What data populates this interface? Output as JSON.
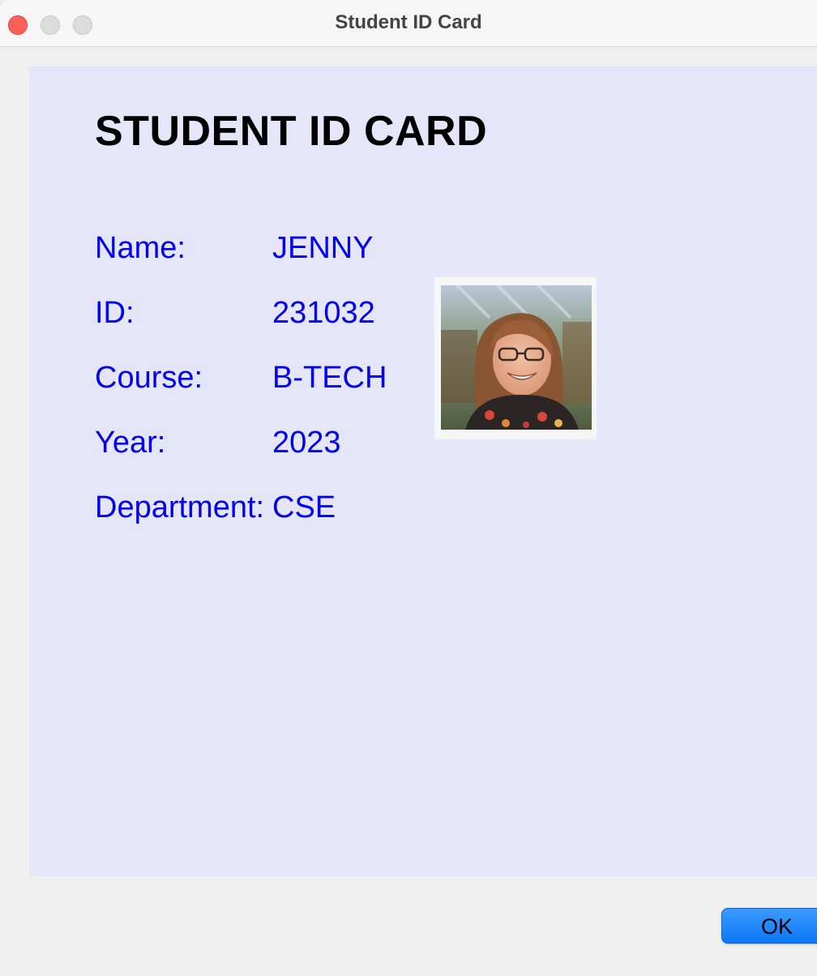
{
  "window": {
    "title": "Student ID Card",
    "controls": {
      "close_color": "#fe5f57",
      "min_color": "#dcdcdc",
      "max_color": "#dcdcdc"
    }
  },
  "card": {
    "background": "#e6e6fa",
    "heading": "STUDENT ID CARD",
    "text_color": "#0000ee",
    "fields": [
      {
        "label": "Name:",
        "value": "JENNY"
      },
      {
        "label": "ID:",
        "value": "231032"
      },
      {
        "label": "Course:",
        "value": "B-TECH"
      },
      {
        "label": "Year:",
        "value": "2023"
      },
      {
        "label": "Department:",
        "value": "CSE"
      }
    ],
    "photo_icon": "student-photo"
  },
  "footer": {
    "ok_label": "OK",
    "ok_color": "#0a78f5"
  }
}
